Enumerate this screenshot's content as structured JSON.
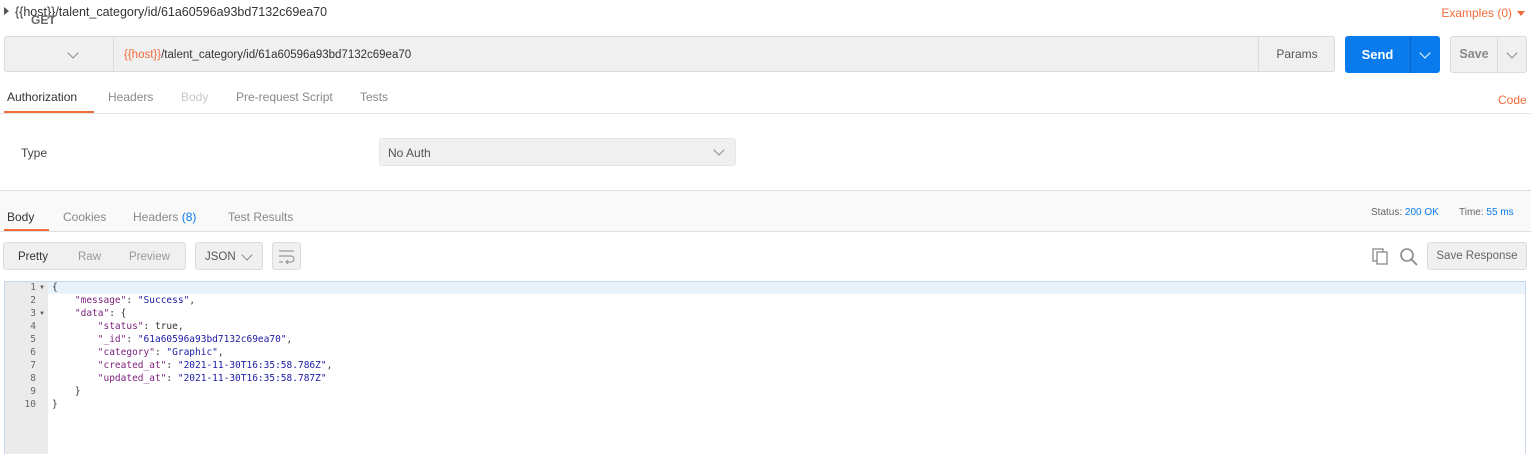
{
  "request": {
    "title": "{{host}}/talent_category/id/61a60596a93bd7132c69ea70",
    "examples_label": "Examples (0)",
    "method": "GET",
    "url_variable": "{{host}}",
    "url_path": "/talent_category/id/61a60596a93bd7132c69ea70",
    "params_label": "Params",
    "send_label": "Send",
    "save_label": "Save"
  },
  "request_tabs": [
    {
      "label": "Authorization",
      "state": "active"
    },
    {
      "label": "Headers",
      "state": "normal"
    },
    {
      "label": "Body",
      "state": "disabled"
    },
    {
      "label": "Pre-request Script",
      "state": "normal"
    },
    {
      "label": "Tests",
      "state": "normal"
    }
  ],
  "code_label": "Code",
  "auth": {
    "type_label": "Type",
    "type_value": "No Auth"
  },
  "response_tabs": {
    "body": "Body",
    "cookies": "Cookies",
    "headers": "Headers",
    "headers_count": "(8)",
    "test_results": "Test Results"
  },
  "response_meta": {
    "status_label": "Status:",
    "status_value": "200 OK",
    "time_label": "Time:",
    "time_value": "55 ms"
  },
  "view_modes": [
    "Pretty",
    "Raw",
    "Preview"
  ],
  "active_view": "Pretty",
  "format_label": "JSON",
  "save_response_label": "Save Response",
  "icons": [
    "caret-right-icon",
    "caret-down-icon",
    "chevron-down-icon",
    "wrap-lines-icon",
    "copy-icon",
    "search-icon"
  ],
  "colors": {
    "accent": "#f26b3a",
    "send": "#097bed",
    "status": "#097bed"
  },
  "response_body": {
    "line_numbers": [
      "1",
      "2",
      "3",
      "4",
      "5",
      "6",
      "7",
      "8",
      "9",
      "10"
    ],
    "message_key": "\"message\"",
    "message_value": "\"Success\"",
    "data_key": "\"data\"",
    "status_key": "\"status\"",
    "status_value": "true",
    "id_key": "\"_id\"",
    "id_value": "\"61a60596a93bd7132c69ea70\"",
    "category_key": "\"category\"",
    "category_value": "\"Graphic\"",
    "created_key": "\"created_at\"",
    "created_value": "\"2021-11-30T16:35:58.786Z\"",
    "updated_key": "\"updated_at\"",
    "updated_value": "\"2021-11-30T16:35:58.787Z\""
  }
}
